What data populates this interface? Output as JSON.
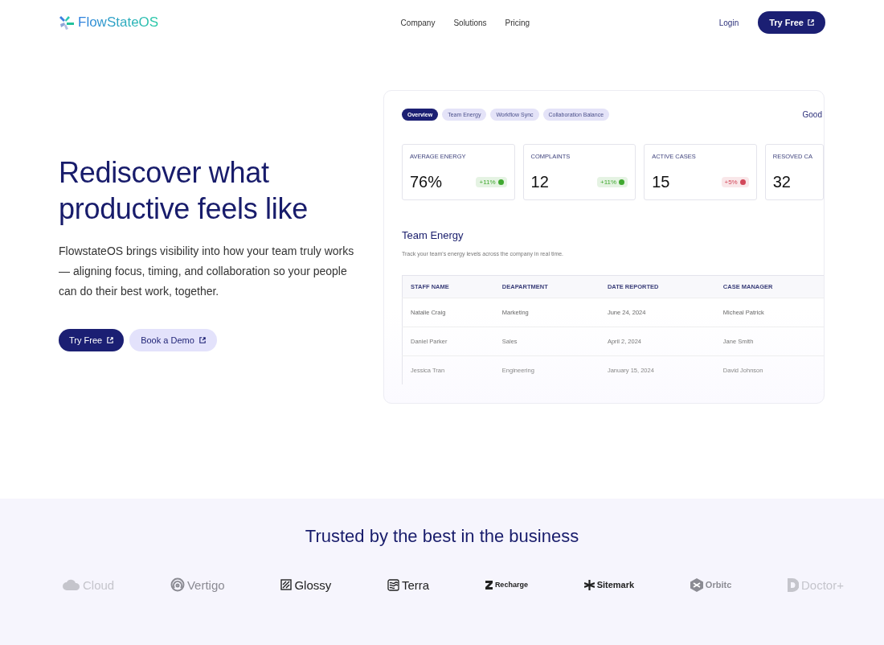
{
  "nav": {
    "brand": "FlowStateOS",
    "links": [
      "Company",
      "Solutions",
      "Pricing"
    ],
    "login": "Login",
    "cta": "Try Free"
  },
  "hero": {
    "title": "Rediscover what productive feels like",
    "body": "FlowstateOS brings visibility into how your team truly works — aligning focus, timing, and collaboration so your people can do their best work, together.",
    "primary": "Try Free",
    "secondary": "Book a Demo"
  },
  "dashboard": {
    "tabs": [
      {
        "label": "Overview",
        "selected": true
      },
      {
        "label": "Team Energy",
        "selected": false
      },
      {
        "label": "Workflow Sync",
        "selected": false
      },
      {
        "label": "Collaboration Balance",
        "selected": false
      }
    ],
    "greeting": "Good",
    "stats": [
      {
        "label": "AVERAGE ENERGY",
        "value": "76%",
        "delta": "+11%",
        "color": "#3fa82f"
      },
      {
        "label": "COMPLAINTS",
        "value": "12",
        "delta": "+11%",
        "color": "#3fa82f"
      },
      {
        "label": "ACTIVE CASES",
        "value": "15",
        "delta": "+5%",
        "color": "#d2485a"
      },
      {
        "label": "RESOVED CA",
        "value": "32"
      }
    ],
    "section_title": "Team Energy",
    "section_subtitle": "Track your team's energy levels across the company in real time.",
    "table": {
      "columns": [
        "STAFF NAME",
        "DEAPARTMENT",
        "DATE REPORTED",
        "CASE MANAGER"
      ],
      "rows": [
        [
          "Natalie Craig",
          "Marketing",
          "June 24, 2024",
          "Micheal Patrick"
        ],
        [
          "Daniel Parker",
          "Sales",
          "April 2, 2024",
          "Jane Smith"
        ],
        [
          "Jessica Tran",
          "Engineering",
          "January 15, 2024",
          "David Johnson"
        ]
      ]
    }
  },
  "trusted": {
    "title": "Trusted by the best in the business",
    "logos": [
      "Cloud",
      "Vertigo",
      "Glossy",
      "Terra",
      "Recharge",
      "Sitemark",
      "Orbitc",
      "Doctor+"
    ]
  }
}
